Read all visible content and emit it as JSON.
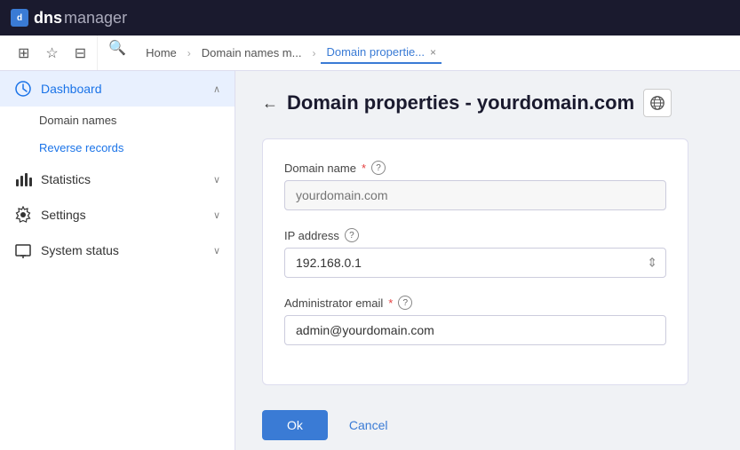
{
  "topbar": {
    "logo_box": "d",
    "logo_bold": "dns",
    "logo_light": "manager"
  },
  "navtabs": {
    "icons": [
      "grid-icon",
      "star-icon",
      "tag-icon",
      "search-icon"
    ],
    "breadcrumbs": [
      {
        "label": "Home",
        "active": false
      },
      {
        "label": "Domain names m...",
        "active": false
      },
      {
        "label": "Domain propertie...",
        "active": true
      }
    ],
    "close_label": "×"
  },
  "sidebar": {
    "items": [
      {
        "id": "dashboard",
        "label": "Dashboard",
        "icon": "dashboard-icon",
        "expanded": true,
        "children": [
          {
            "id": "domain-names",
            "label": "Domain names"
          },
          {
            "id": "reverse-records",
            "label": "Reverse records"
          }
        ]
      },
      {
        "id": "statistics",
        "label": "Statistics",
        "icon": "statistics-icon",
        "expanded": false,
        "children": []
      },
      {
        "id": "settings",
        "label": "Settings",
        "icon": "settings-icon",
        "expanded": false,
        "children": []
      },
      {
        "id": "system-status",
        "label": "System status",
        "icon": "system-status-icon",
        "expanded": false,
        "children": []
      }
    ]
  },
  "page": {
    "title": "Domain properties - yourdomain.com",
    "back_label": "←",
    "form": {
      "domain_name_label": "Domain name",
      "domain_name_required": "*",
      "domain_name_placeholder": "yourdomain.com",
      "ip_address_label": "IP address",
      "ip_address_value": "192.168.0.1",
      "admin_email_label": "Administrator email",
      "admin_email_required": "*",
      "admin_email_value": "admin@yourdomain.com"
    },
    "ok_button": "Ok",
    "cancel_button": "Cancel"
  }
}
